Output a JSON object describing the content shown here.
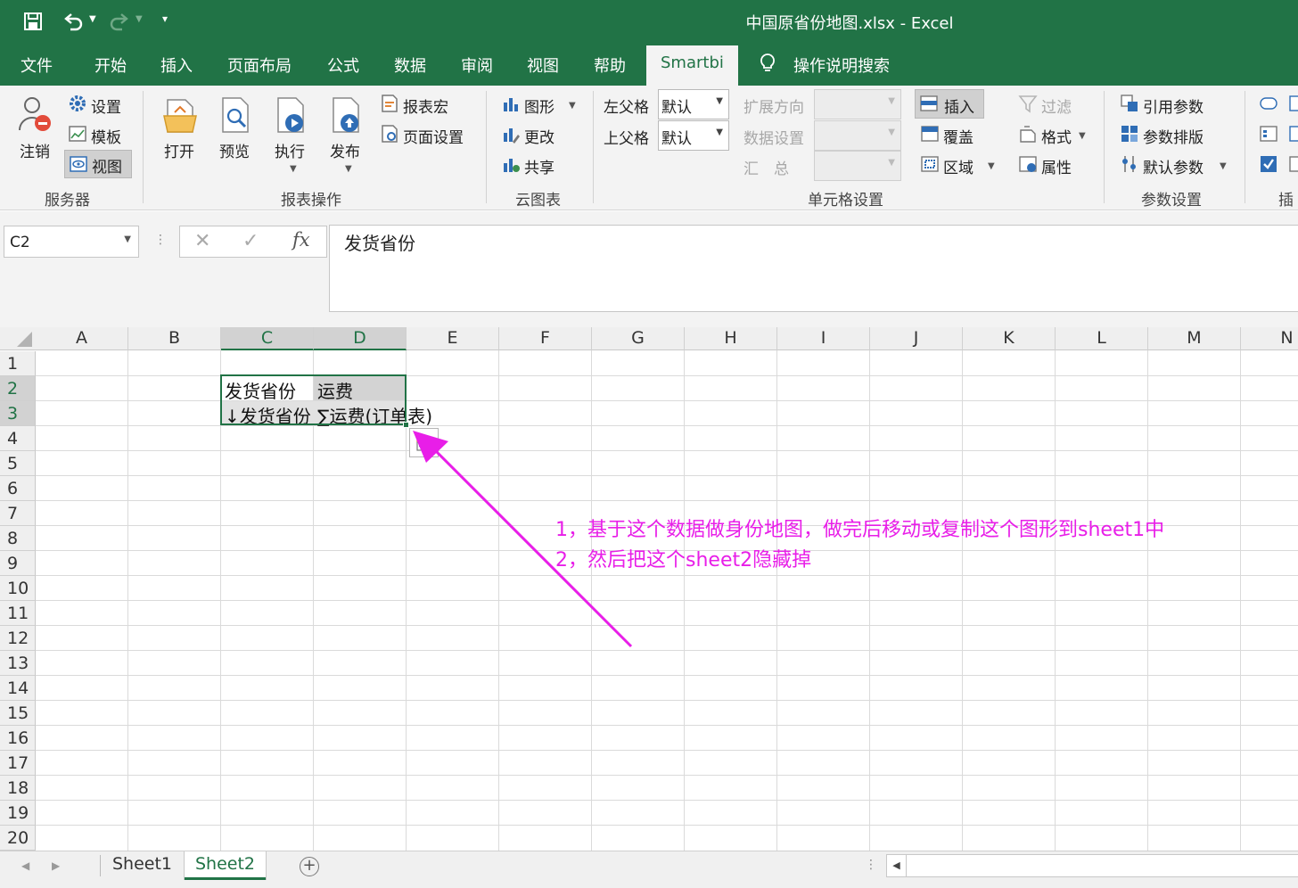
{
  "window": {
    "title": "中国原省份地图.xlsx  -  Excel"
  },
  "tabs": [
    {
      "label": "文件",
      "active": false
    },
    {
      "label": "开始",
      "active": false
    },
    {
      "label": "插入",
      "active": false
    },
    {
      "label": "页面布局",
      "active": false
    },
    {
      "label": "公式",
      "active": false
    },
    {
      "label": "数据",
      "active": false
    },
    {
      "label": "审阅",
      "active": false
    },
    {
      "label": "视图",
      "active": false
    },
    {
      "label": "帮助",
      "active": false
    },
    {
      "label": "Smartbi",
      "active": true
    }
  ],
  "tell_me": "操作说明搜索",
  "ribbon": {
    "server": {
      "label": "服务器",
      "logout": "注销",
      "settings": "设置",
      "template": "模板",
      "view": "视图"
    },
    "report_ops": {
      "label": "报表操作",
      "open": "打开",
      "preview": "预览",
      "run": "执行",
      "publish": "发布",
      "macro": "报表宏",
      "page_setup": "页面设置"
    },
    "cloud_chart": {
      "label": "云图表",
      "chart": "图形",
      "change": "更改",
      "share": "共享"
    },
    "cell_settings": {
      "label": "单元格设置",
      "left_parent": "左父格",
      "left_parent_value": "默认",
      "top_parent": "上父格",
      "top_parent_value": "默认",
      "expand_dir": "扩展方向",
      "data_settings": "数据设置",
      "summary": "汇　总",
      "insert": "插入",
      "cover": "覆盖",
      "region": "区域",
      "filter": "过滤",
      "format": "格式",
      "property": "属性"
    },
    "param_settings": {
      "label": "参数设置",
      "ref_param": "引用参数",
      "param_layout": "参数排版",
      "default_param": "默认参数"
    },
    "insert_group_partial": "插"
  },
  "formula_bar": {
    "namebox": "C2",
    "content": "发货省份"
  },
  "columns": [
    "A",
    "B",
    "C",
    "D",
    "E",
    "F",
    "G",
    "H",
    "I",
    "J",
    "K",
    "L",
    "M",
    "N"
  ],
  "rows": [
    "1",
    "2",
    "3",
    "4",
    "5",
    "6",
    "7",
    "8",
    "9",
    "10",
    "11",
    "12",
    "13",
    "14",
    "15",
    "16",
    "17",
    "18",
    "19",
    "20"
  ],
  "cells": {
    "C2": "发货省份",
    "D2": "运费",
    "C3": "↓发货省份",
    "D3": "∑运费(订单表)"
  },
  "annotation": {
    "line1": "1，基于这个数据做身份地图，做完后移动或复制这个图形到sheet1中",
    "line2": "2，然后把这个sheet2隐藏掉",
    "color": "#e81ee8"
  },
  "sheets": [
    {
      "name": "Sheet1",
      "active": false
    },
    {
      "name": "Sheet2",
      "active": true
    }
  ],
  "colors": {
    "excel_green": "#217346",
    "ribbon_bg": "#f3f3f3"
  }
}
